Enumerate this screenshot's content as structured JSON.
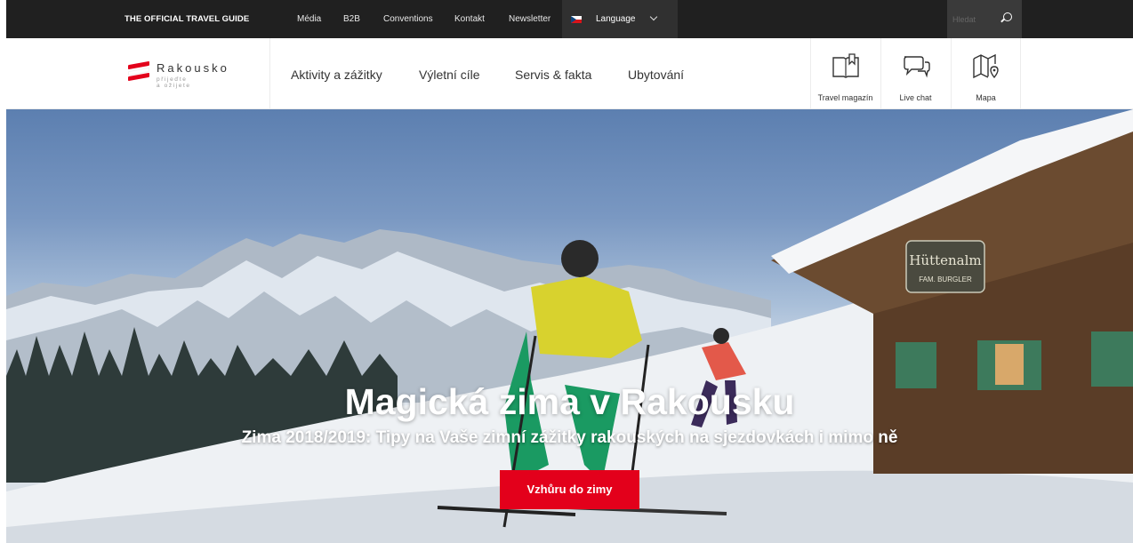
{
  "topbar": {
    "guide": "THE OFFICIAL TRAVEL GUIDE",
    "links": [
      "Média",
      "B2B",
      "Conventions",
      "Kontakt",
      "Newsletter"
    ],
    "language": "Language",
    "search_placeholder": "Hledat"
  },
  "logo": {
    "name": "Rakousko",
    "tagline_1": "přijeďte",
    "tagline_2": "a ožijete"
  },
  "nav": [
    "Aktivity a zážitky",
    "Výletní cíle",
    "Servis & fakta",
    "Ubytování"
  ],
  "tools": [
    {
      "label": "Travel magazín",
      "icon": "book-icon"
    },
    {
      "label": "Live chat",
      "icon": "chat-icon"
    },
    {
      "label": "Mapa",
      "icon": "map-icon"
    }
  ],
  "hero": {
    "title": "Magická zima v Rakousku",
    "subtitle": "Zima 2018/2019: Tipy na Vaše zimní zážitky rakouských na sjezdovkách i mimo ně",
    "cta": "Vzhůru do zimy",
    "hut_sign_1": "Hüttenalm",
    "hut_sign_2": "FAM. BURGLER"
  },
  "colors": {
    "topbar": "#202020",
    "brand_red": "#e3001b",
    "text": "#333333"
  }
}
